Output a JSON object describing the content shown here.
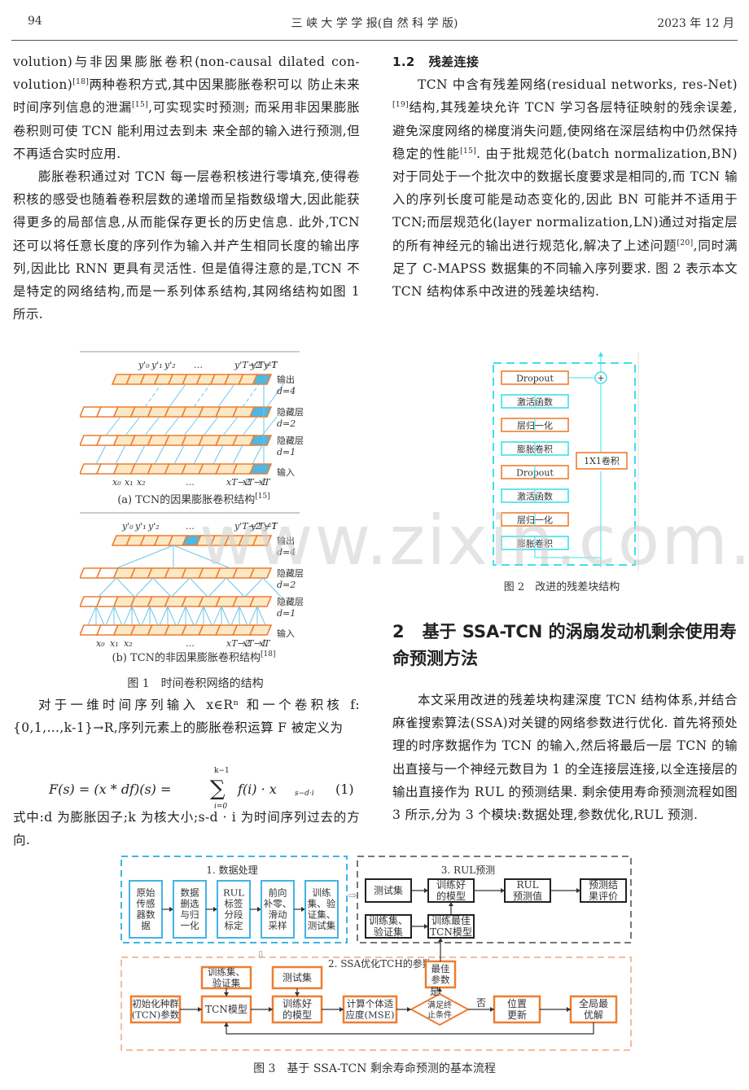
{
  "header": {
    "page_number": "94",
    "journal": "三 峡 大 学 学 报(自 然 科 学 版)",
    "date": "2023 年 12 月"
  },
  "left_column": {
    "para1_lines": [
      "volution)与非因果膨胀卷积(non-causal dilated con-",
      "volution)",
      "两种卷积方式,其中因果膨胀卷积可以",
      "防止未来时间序列信息的泄漏",
      ",可实现实时预测;",
      "而采用非因果膨胀卷积则可使 TCN 能利用过去到未",
      "来全部的输入进行预测,但不再适合实时应用."
    ],
    "ref18": "[18]",
    "ref15": "[15]",
    "para2": "膨胀卷积通过对 TCN 每一层卷积核进行零填充,使得卷积核的感受也随着卷积层数的递增而呈指数级增大,因此能获得更多的局部信息,从而能保存更长的历史信息. 此外,TCN 还可以将任意长度的序列作为输入并产生相同长度的输出序列,因此比 RNN 更具有灵活性. 但是值得注意的是,TCN 不是特定的网络结构,而是一系列体系结构,其网络结构如图 1 所示.",
    "para3": "对于一维时间序列输入 x∈Rⁿ 和一个卷积核 f:{0,1,…,k-1}→R,序列元素上的膨胀卷积运算 F 被定义为",
    "equation": {
      "lhs": "F(s) = (x * df)(s) = ",
      "sum_top": "k−1",
      "sum_bottom": "i=0",
      "rhs": "f(i) · x",
      "rhs_sub": "s−d·i",
      "number": "(1)"
    },
    "para4": "式中:d 为膨胀因子;k 为核大小;s-d · i 为时间序列过去的方向."
  },
  "figure1": {
    "sub_a_caption": "(a) TCN的因果膨胀卷积结构",
    "sub_a_ref": "[15]",
    "sub_b_caption": "(b) TCN的非因果膨胀卷积结构",
    "sub_b_ref": "[18]",
    "caption": "图 1　时间卷积网络的结构",
    "layer_labels": [
      "输出",
      "d=4",
      "隐藏层",
      "d=2",
      "隐藏层",
      "d=1",
      "输入"
    ],
    "top_labels": [
      "y'₀",
      "y'₁",
      "y'₂",
      "…",
      "y'T−2",
      "y'T−1",
      "y'T"
    ],
    "bottom_labels": [
      "x₀",
      "x₁",
      "x₂",
      "…",
      "xT−2",
      "xT−1",
      "xT"
    ],
    "colors": {
      "cell_fill": "#fbe8c4",
      "cell_border": "#ee7d31",
      "highlight": "#4fb7e3",
      "link": "#6cc6e8"
    }
  },
  "right_column": {
    "section_1_2": {
      "number": "1.2",
      "title": "残差连接"
    },
    "para1": "TCN 中含有残差网络(residual networks, res-Net)",
    "ref19": "[19]",
    "para1b": "结构,其残差块允许 TCN 学习各层特征映射的残余误差,避免深度网络的梯度消失问题,使网络在深层结构中仍然保持稳定的性能",
    "ref15": "[15]",
    "para1c": ". 由于批规范化(batch normalization,BN)对于同处于一个批次中的数据长度要求是相同的,而 TCN 输入的序列长度可能是动态变化的,因此 BN 可能并不适用于 TCN;而层规范化(layer normalization,LN)通过对指定层的所有神经元的输出进行规范化,解决了上述问题",
    "ref20": "[20]",
    "para1d": ",同时满足了 C-MAPSS 数据集的不同输入序列要求. 图 2 表示本文 TCN 结构体系中改进的残差块结构.",
    "section_2": {
      "number": "2",
      "title": "基于 SSA-TCN 的涡扇发动机剩余使用寿命预测方法"
    },
    "para2": "本文采用改进的残差块构建深度 TCN 结构体系,并结合麻雀搜索算法(SSA)对关键的网络参数进行优化. 首先将预处理的时序数据作为 TCN 的输入,然后将最后一层 TCN 的输出直接与一个神经元数目为 1 的全连接层连接,以全连接层的输出直接作为 RUL 的预测结果. 剩余使用寿命预测流程如图 3 所示,分为 3 个模块:数据处理,参数优化,RUL 预测."
  },
  "figure2": {
    "blocks": [
      "Dropout",
      "激活函数",
      "层归一化",
      "膨胀卷积",
      "Dropout",
      "激活函数",
      "层归一化",
      "膨胀卷积"
    ],
    "block_kinds": [
      "orange",
      "cyan",
      "orange",
      "cyan",
      "orange",
      "cyan",
      "orange",
      "cyan"
    ],
    "shortcut": "1X1卷积",
    "add_symbol": "+",
    "caption": "图 2　改进的残差块结构",
    "colors": {
      "cyan": "#3ee0e8",
      "orange": "#ee7d31"
    }
  },
  "figure3": {
    "module1": {
      "title": "1. 数据处理",
      "steps": [
        [
          "原始",
          "传感",
          "器数",
          "据"
        ],
        [
          "数据",
          "删选",
          "与归",
          "一化"
        ],
        [
          "RUL",
          "标签",
          "分段",
          "标定"
        ],
        [
          "前向",
          "补零、",
          "滑动",
          "采样"
        ],
        [
          "训练",
          "集、验",
          "证集、",
          "测试集"
        ]
      ]
    },
    "module3": {
      "title": "3. RUL预测",
      "test_set": "测试集",
      "trained_model": [
        "训练好",
        "的模型"
      ],
      "rul_value": [
        "RUL",
        "预测值"
      ],
      "evaluation": [
        "预测结",
        "果评价"
      ],
      "train_val": [
        "训练集、",
        "验证集"
      ],
      "best_tcn": [
        "训练最佳",
        "TCN模型"
      ]
    },
    "module2": {
      "title": "2. SSA优化TCH的参数",
      "init": [
        "初始化种群",
        "(TCN)参数"
      ],
      "train_val": [
        "训练集、",
        "验证集"
      ],
      "tcn_model": "TCN模型",
      "test_set": "测试集",
      "trained_model": [
        "训练好",
        "的模型"
      ],
      "fitness": [
        "计算个体适",
        "应度(MSE)"
      ],
      "condition": [
        "满足终",
        "止条件"
      ],
      "yes": "是",
      "no": "否",
      "best_params": [
        "最佳",
        "参数"
      ],
      "update": [
        "位置",
        "更新"
      ],
      "global_best": [
        "全局最",
        "优解"
      ]
    },
    "caption": "图 3　基于 SSA-TCN 剩余寿命预测的基本流程",
    "colors": {
      "module1": "#41b4e6",
      "module2": "#f2a57a",
      "module3": "#777777",
      "box2": "#ee7d31"
    }
  },
  "watermark": "www.zixin.com.cn"
}
